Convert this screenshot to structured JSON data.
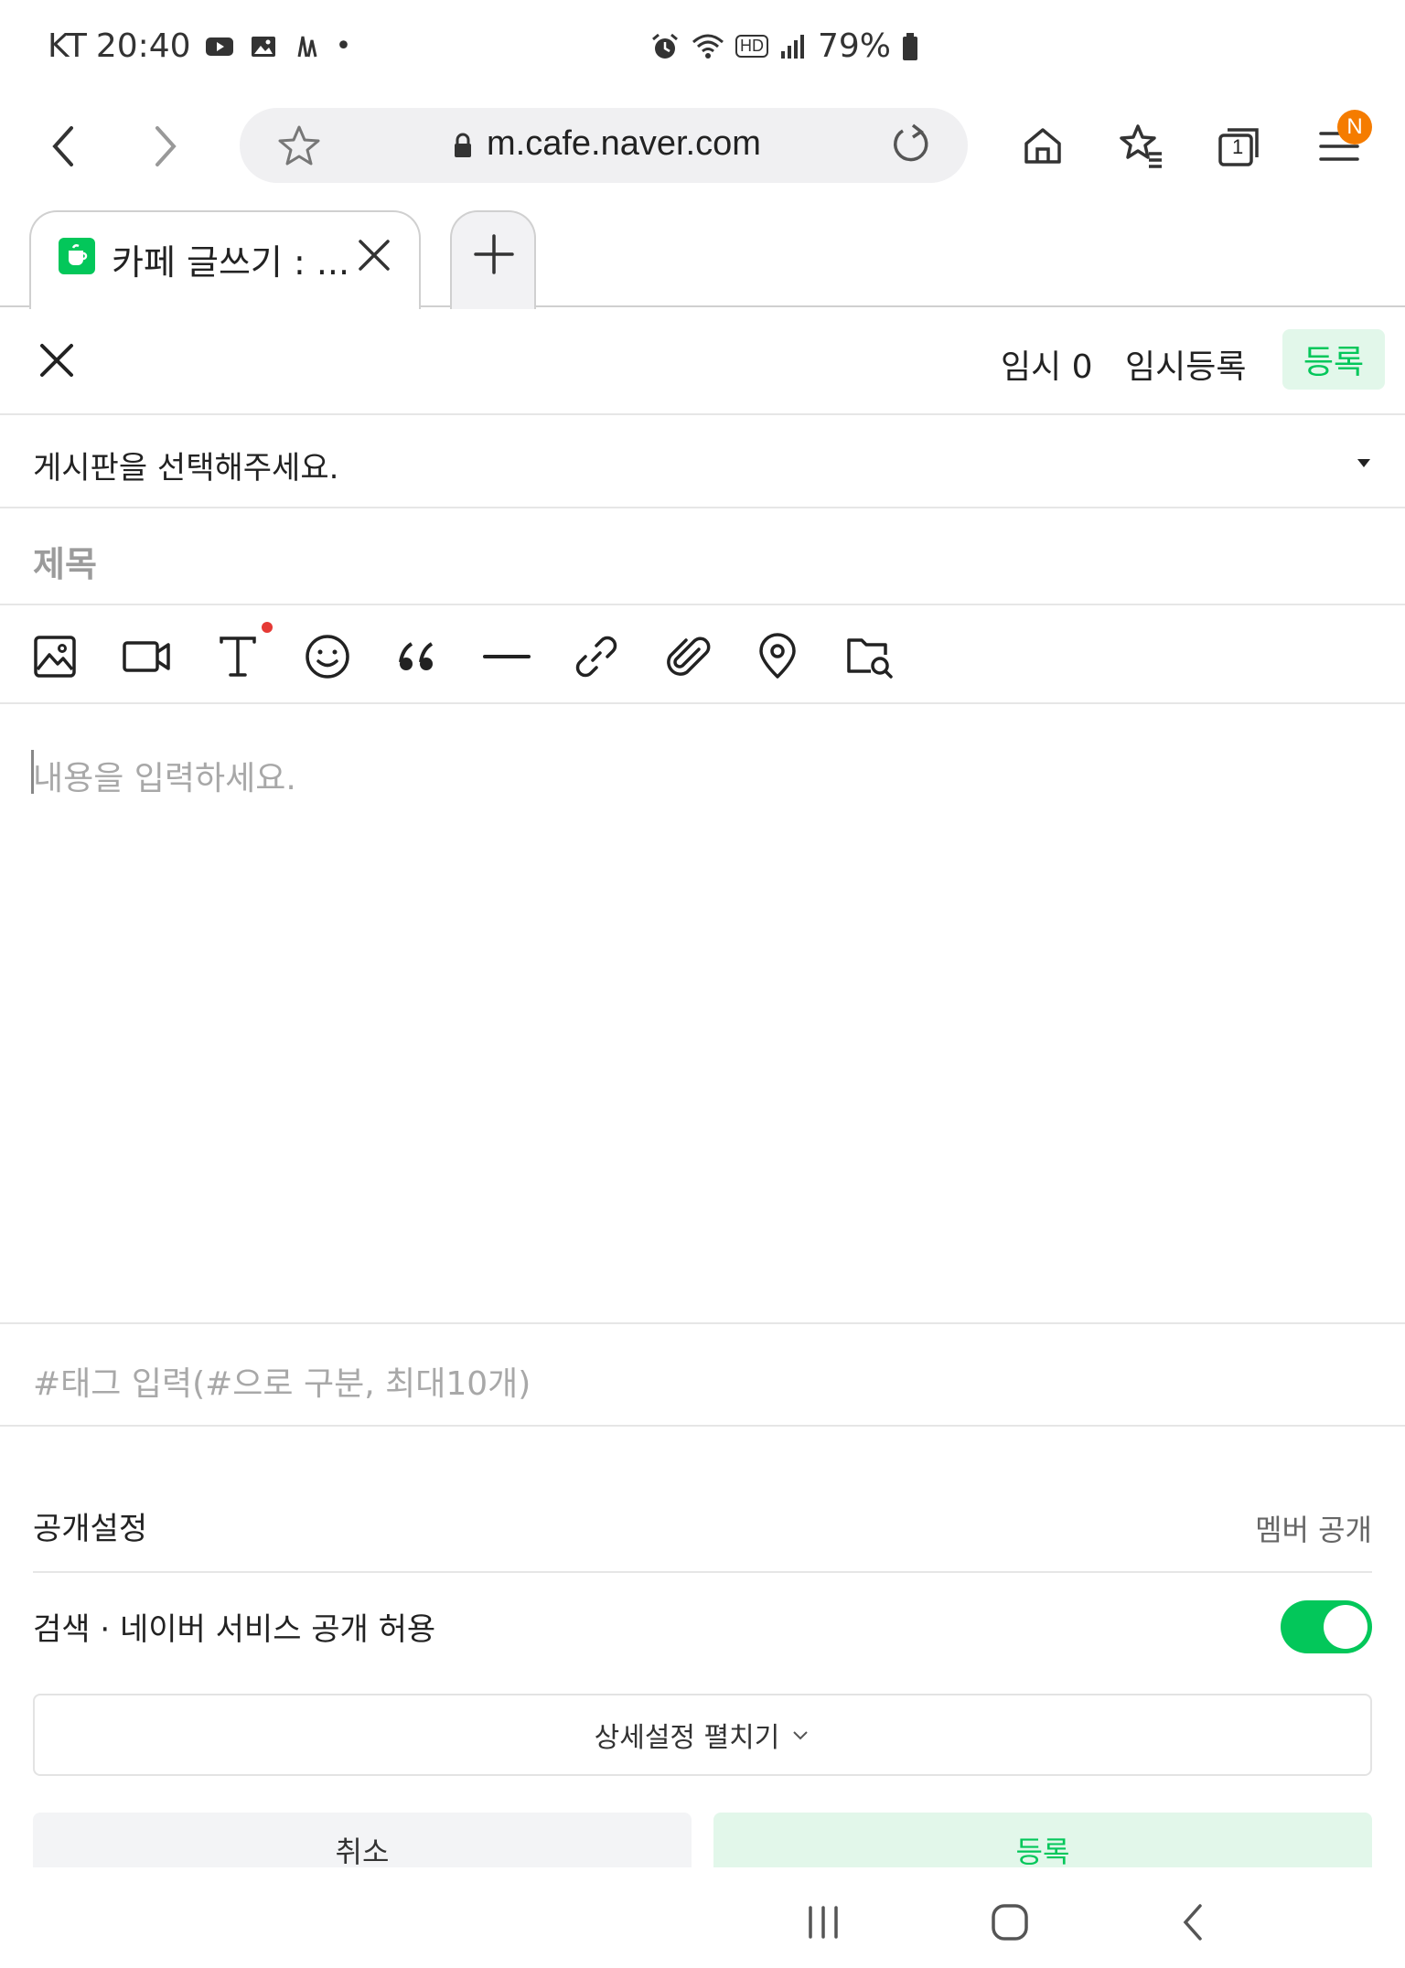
{
  "status_bar": {
    "carrier": "KT",
    "time": "20:40",
    "battery": "79%",
    "hd_label": "HD"
  },
  "browser": {
    "url": "m.cafe.naver.com",
    "menu_badge": "N",
    "tab_title": "카페 글쓰기 : ...",
    "tab_count": "1"
  },
  "editor": {
    "temp_count_label": "임시 0",
    "temp_save_label": "임시등록",
    "submit_label": "등록",
    "board_placeholder": "게시판을 선택해주세요.",
    "title_placeholder": "제목",
    "content_placeholder": "내용을 입력하세요.",
    "tag_placeholder": "#태그 입력(#으로 구분, 최대10개)"
  },
  "toolbar": {
    "tools": [
      "image-icon",
      "video-icon",
      "text-style-icon",
      "sticker-icon",
      "quote-icon",
      "divider-icon",
      "link-icon",
      "attach-icon",
      "place-icon",
      "search-library-icon"
    ]
  },
  "settings": {
    "visibility_label": "공개설정",
    "visibility_value": "멤버 공개",
    "search_allow_label": "검색 · 네이버 서비스 공개 허용",
    "search_allow_on": true,
    "expand_label": "상세설정 펼치기"
  },
  "bottom": {
    "cancel_label": "취소",
    "submit_label": "등록"
  },
  "colors": {
    "accent": "#03c75a",
    "accent_bg": "#e2f7ea",
    "badge": "#f57c00"
  }
}
